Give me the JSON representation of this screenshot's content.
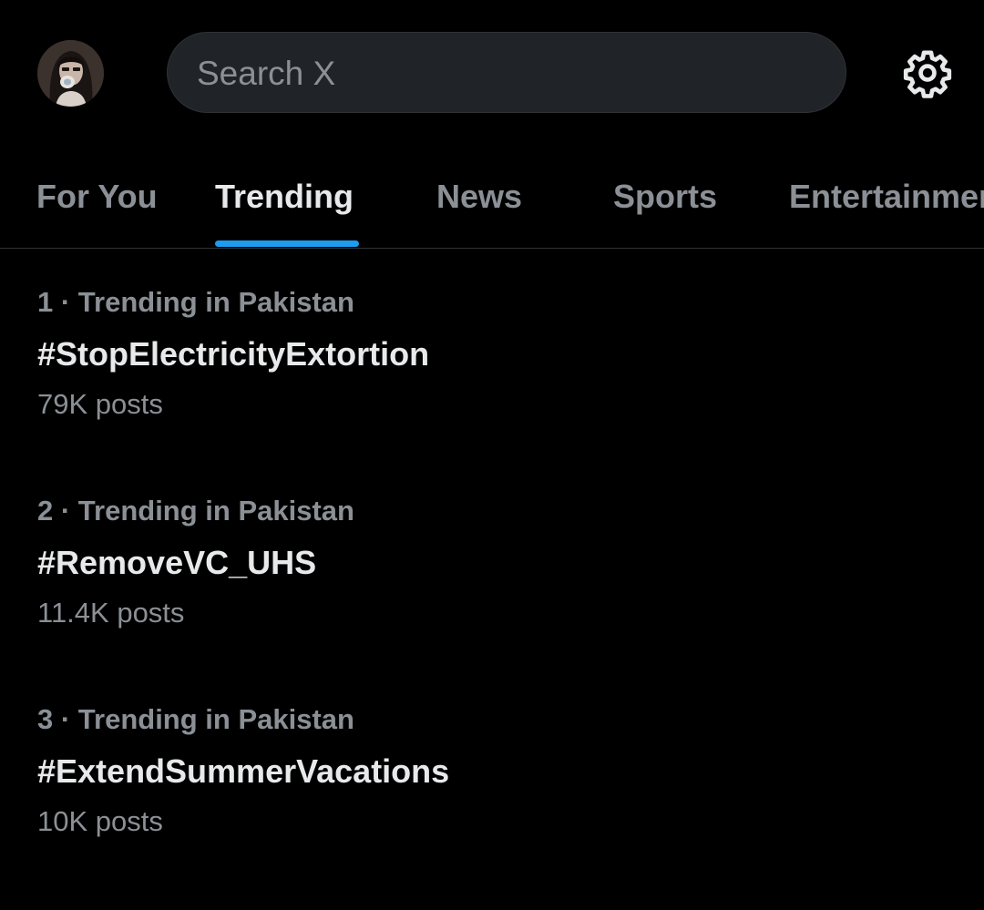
{
  "header": {
    "avatar_icon": "profile-avatar",
    "search": {
      "placeholder": "Search X",
      "value": ""
    },
    "settings_icon": "gear-icon"
  },
  "tabs": [
    {
      "label": "For You",
      "active": false
    },
    {
      "label": "Trending",
      "active": true
    },
    {
      "label": "News",
      "active": false
    },
    {
      "label": "Sports",
      "active": false
    },
    {
      "label": "Entertainment",
      "active": false
    }
  ],
  "trends": [
    {
      "meta": "1 · Trending in Pakistan",
      "title": "#StopElectricityExtortion",
      "count": "79K posts"
    },
    {
      "meta": "2 · Trending in Pakistan",
      "title": "#RemoveVC_UHS",
      "count": "11.4K posts"
    },
    {
      "meta": "3 · Trending in Pakistan",
      "title": "#ExtendSummerVacations",
      "count": "10K posts"
    }
  ],
  "colors": {
    "background": "#000000",
    "accent": "#1d9bf0",
    "text_primary": "#e7e9ea",
    "text_secondary": "#8b9096",
    "search_bg": "#202327",
    "divider": "#2f3336"
  }
}
